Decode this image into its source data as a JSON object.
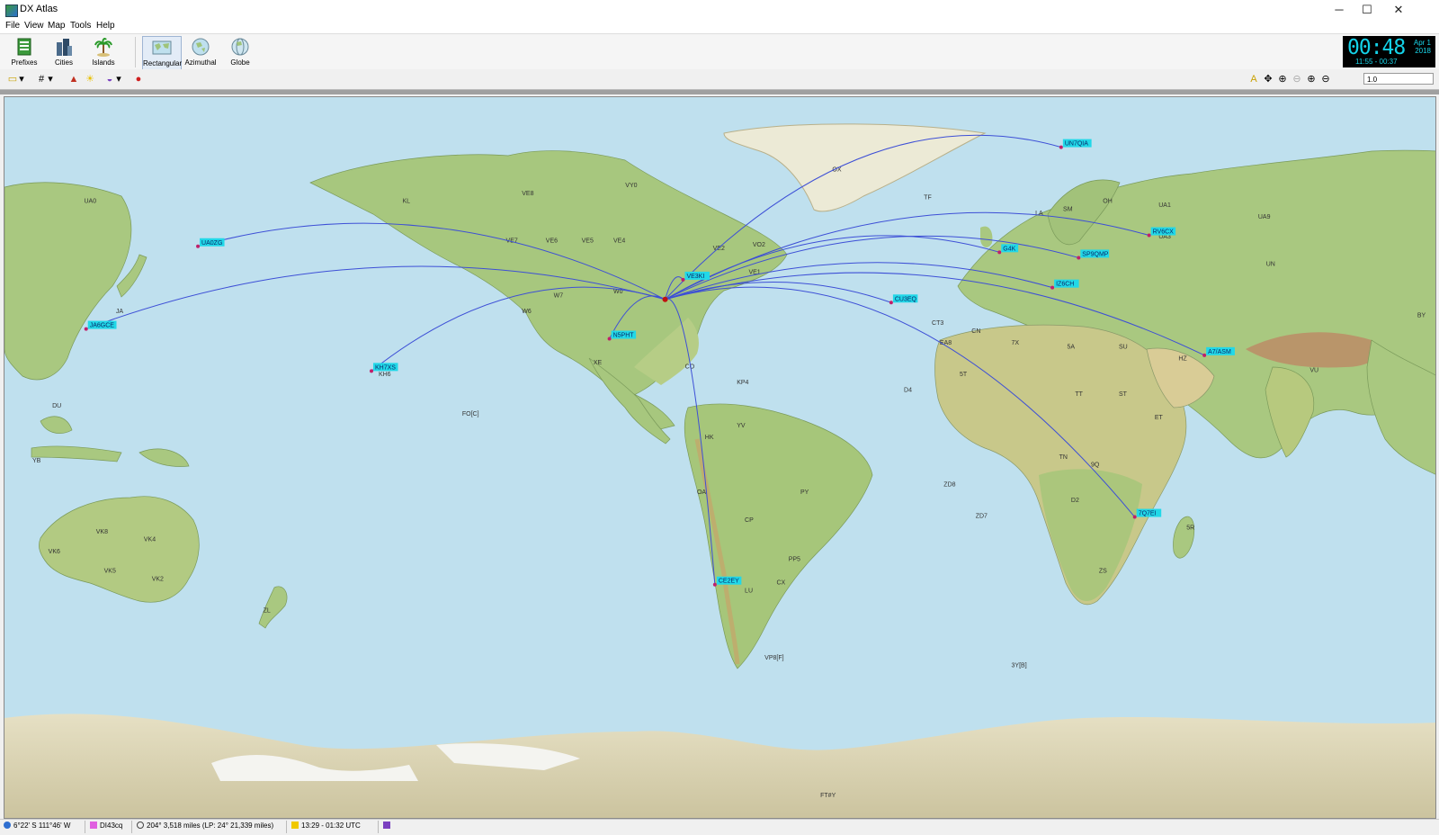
{
  "window": {
    "title": "DX Atlas",
    "minimize": "─",
    "maximize": "☐",
    "close": "✕"
  },
  "menu": [
    "File",
    "View",
    "Map",
    "Tools",
    "Help"
  ],
  "toolbar": {
    "prefixes": "Prefixes",
    "cities": "Cities",
    "islands": "Islands",
    "rectangular": "Rectangular",
    "azimuthal": "Azimuthal",
    "globe": "Globe"
  },
  "clock": {
    "time": "00:48",
    "date_line1": "Apr 1",
    "date_line2": "2018",
    "range": "11:55 - 00:37"
  },
  "zoom_value": "1.0",
  "map": {
    "spots": [
      {
        "label": "UA0ZG",
        "lon": 158.6,
        "lat": 53.0
      },
      {
        "label": "JA6GCE",
        "lon": 130.5,
        "lat": 32.0
      },
      {
        "label": "KH7XS",
        "lon": -157.8,
        "lat": 21.3
      },
      {
        "label": "VE3KI",
        "lon": -79.5,
        "lat": 44.5
      },
      {
        "label": "N5PHT",
        "lon": -98.0,
        "lat": 29.5
      },
      {
        "label": "CE2EY",
        "lon": -71.5,
        "lat": -33.0
      },
      {
        "label": "CU3EQ",
        "lon": -27.2,
        "lat": 38.7
      },
      {
        "label": "UN7QIA",
        "lon": 15.5,
        "lat": 78.2
      },
      {
        "label": "G4K",
        "lon": 0.0,
        "lat": 51.5
      },
      {
        "label": "SP9QMP",
        "lon": 19.9,
        "lat": 50.1
      },
      {
        "label": "IZ6CH",
        "lon": 13.3,
        "lat": 42.5
      },
      {
        "label": "RV6CX",
        "lon": 37.6,
        "lat": 55.8
      },
      {
        "label": "A7/ASM",
        "lon": 51.5,
        "lat": 25.3
      },
      {
        "label": "7Q7EI",
        "lon": 34.0,
        "lat": -15.8
      }
    ],
    "home": {
      "lon": -84.0,
      "lat": 39.5
    },
    "prefixes": [
      {
        "t": "KL",
        "lon": -150,
        "lat": 64
      },
      {
        "t": "VE8",
        "lon": -120,
        "lat": 66
      },
      {
        "t": "VY0",
        "lon": -94,
        "lat": 68
      },
      {
        "t": "VE7",
        "lon": -124,
        "lat": 54
      },
      {
        "t": "VE6",
        "lon": -114,
        "lat": 54
      },
      {
        "t": "VE5",
        "lon": -105,
        "lat": 54
      },
      {
        "t": "VE4",
        "lon": -97,
        "lat": 54
      },
      {
        "t": "VE2",
        "lon": -72,
        "lat": 52
      },
      {
        "t": "VO2",
        "lon": -62,
        "lat": 53
      },
      {
        "t": "VE1",
        "lon": -63,
        "lat": 46
      },
      {
        "t": "W7",
        "lon": -112,
        "lat": 40
      },
      {
        "t": "W0",
        "lon": -97,
        "lat": 41
      },
      {
        "t": "W6",
        "lon": -120,
        "lat": 36
      },
      {
        "t": "XE",
        "lon": -102,
        "lat": 23
      },
      {
        "t": "CO",
        "lon": -79,
        "lat": 22
      },
      {
        "t": "KP4",
        "lon": -66,
        "lat": 18
      },
      {
        "t": "HK",
        "lon": -74,
        "lat": 4
      },
      {
        "t": "YV",
        "lon": -66,
        "lat": 7
      },
      {
        "t": "PY",
        "lon": -50,
        "lat": -10
      },
      {
        "t": "PP5",
        "lon": -53,
        "lat": -27
      },
      {
        "t": "OA",
        "lon": -76,
        "lat": -10
      },
      {
        "t": "CP",
        "lon": -64,
        "lat": -17
      },
      {
        "t": "LU",
        "lon": -64,
        "lat": -35
      },
      {
        "t": "CX",
        "lon": -56,
        "lat": -33
      },
      {
        "t": "OX",
        "lon": -42,
        "lat": 72
      },
      {
        "t": "TF",
        "lon": -19,
        "lat": 65
      },
      {
        "t": "LA",
        "lon": 9,
        "lat": 61
      },
      {
        "t": "SM",
        "lon": 16,
        "lat": 62
      },
      {
        "t": "OH",
        "lon": 26,
        "lat": 64
      },
      {
        "t": "UA1",
        "lon": 40,
        "lat": 63
      },
      {
        "t": "UA3",
        "lon": 40,
        "lat": 55
      },
      {
        "t": "UA9",
        "lon": 65,
        "lat": 60
      },
      {
        "t": "UA0",
        "lon": 130,
        "lat": 64
      },
      {
        "t": "UN",
        "lon": 67,
        "lat": 48
      },
      {
        "t": "BY",
        "lon": 105,
        "lat": 35
      },
      {
        "t": "JA",
        "lon": 138,
        "lat": 36
      },
      {
        "t": "VU",
        "lon": 78,
        "lat": 21
      },
      {
        "t": "HZ",
        "lon": 45,
        "lat": 24
      },
      {
        "t": "SU",
        "lon": 30,
        "lat": 27
      },
      {
        "t": "5A",
        "lon": 17,
        "lat": 27
      },
      {
        "t": "7X",
        "lon": 3,
        "lat": 28
      },
      {
        "t": "CN",
        "lon": -7,
        "lat": 31
      },
      {
        "t": "5T",
        "lon": -10,
        "lat": 20
      },
      {
        "t": "TT",
        "lon": 19,
        "lat": 15
      },
      {
        "t": "ST",
        "lon": 30,
        "lat": 15
      },
      {
        "t": "ET",
        "lon": 39,
        "lat": 9
      },
      {
        "t": "TN",
        "lon": 15,
        "lat": -1
      },
      {
        "t": "9Q",
        "lon": 23,
        "lat": -3
      },
      {
        "t": "D2",
        "lon": 18,
        "lat": -12
      },
      {
        "t": "ZS",
        "lon": 25,
        "lat": -30
      },
      {
        "t": "5R",
        "lon": 47,
        "lat": -19
      },
      {
        "t": "VK6",
        "lon": 121,
        "lat": -25
      },
      {
        "t": "VK8",
        "lon": 133,
        "lat": -20
      },
      {
        "t": "VK4",
        "lon": 145,
        "lat": -22
      },
      {
        "t": "VK5",
        "lon": 135,
        "lat": -30
      },
      {
        "t": "VK2",
        "lon": 147,
        "lat": -32
      },
      {
        "t": "ZL",
        "lon": 175,
        "lat": -40
      },
      {
        "t": "KH6",
        "lon": -156,
        "lat": 20
      },
      {
        "t": "YB",
        "lon": 117,
        "lat": -2
      },
      {
        "t": "DU",
        "lon": 122,
        "lat": 12
      },
      {
        "t": "3Y[B]",
        "lon": 3,
        "lat": -54
      },
      {
        "t": "ZD8",
        "lon": -14,
        "lat": -8
      },
      {
        "t": "ZD7",
        "lon": -6,
        "lat": -16
      },
      {
        "t": "CT3",
        "lon": -17,
        "lat": 33
      },
      {
        "t": "EA8",
        "lon": -15,
        "lat": 28
      },
      {
        "t": "D4",
        "lon": -24,
        "lat": 16
      },
      {
        "t": "FO[C]",
        "lon": -135,
        "lat": 10
      },
      {
        "t": "VP8[F]",
        "lon": -59,
        "lat": -52
      },
      {
        "t": "FT#Y",
        "lon": -45,
        "lat": -87
      }
    ]
  },
  "status": {
    "coords": "6°22' S  111°46' W",
    "locator": "DI43cq",
    "bearing": "204°  3,518 miles  (LP: 24°  21,339 miles)",
    "sun": "13:29 - 01:32 UTC"
  }
}
